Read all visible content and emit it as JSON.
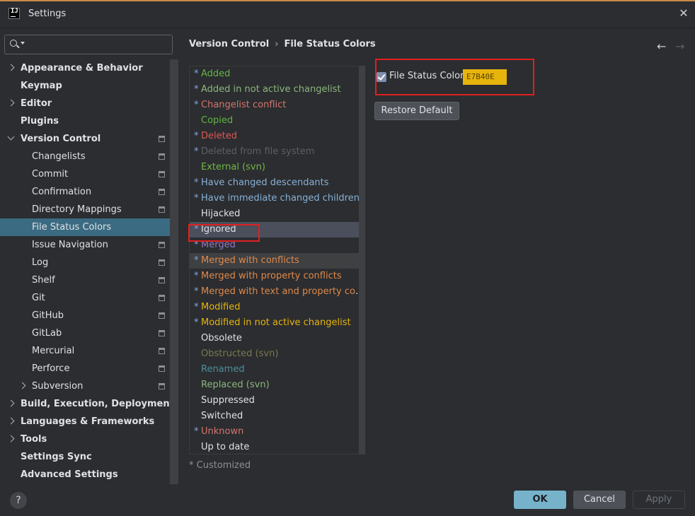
{
  "window": {
    "title": "Settings",
    "app_icon_text": "IJ"
  },
  "search": {
    "placeholder": ""
  },
  "sidebar": {
    "items": [
      {
        "label": "Appearance & Behavior",
        "level": 0,
        "bold": true,
        "chevron": "right",
        "proj": false
      },
      {
        "label": "Keymap",
        "level": 0,
        "bold": true,
        "chevron": "",
        "proj": false
      },
      {
        "label": "Editor",
        "level": 0,
        "bold": true,
        "chevron": "right",
        "proj": false
      },
      {
        "label": "Plugins",
        "level": 0,
        "bold": true,
        "chevron": "",
        "proj": false
      },
      {
        "label": "Version Control",
        "level": 0,
        "bold": true,
        "chevron": "down",
        "proj": true
      },
      {
        "label": "Changelists",
        "level": 1,
        "bold": false,
        "chevron": "",
        "proj": true
      },
      {
        "label": "Commit",
        "level": 1,
        "bold": false,
        "chevron": "",
        "proj": true
      },
      {
        "label": "Confirmation",
        "level": 1,
        "bold": false,
        "chevron": "",
        "proj": true
      },
      {
        "label": "Directory Mappings",
        "level": 1,
        "bold": false,
        "chevron": "",
        "proj": true
      },
      {
        "label": "File Status Colors",
        "level": 1,
        "bold": false,
        "chevron": "",
        "proj": false,
        "selected": true
      },
      {
        "label": "Issue Navigation",
        "level": 1,
        "bold": false,
        "chevron": "",
        "proj": true
      },
      {
        "label": "Log",
        "level": 1,
        "bold": false,
        "chevron": "",
        "proj": true
      },
      {
        "label": "Shelf",
        "level": 1,
        "bold": false,
        "chevron": "",
        "proj": true
      },
      {
        "label": "Git",
        "level": 1,
        "bold": false,
        "chevron": "",
        "proj": true
      },
      {
        "label": "GitHub",
        "level": 1,
        "bold": false,
        "chevron": "",
        "proj": true
      },
      {
        "label": "GitLab",
        "level": 1,
        "bold": false,
        "chevron": "",
        "proj": true
      },
      {
        "label": "Mercurial",
        "level": 1,
        "bold": false,
        "chevron": "",
        "proj": true
      },
      {
        "label": "Perforce",
        "level": 1,
        "bold": false,
        "chevron": "",
        "proj": true
      },
      {
        "label": "Subversion",
        "level": 1,
        "bold": false,
        "chevron": "right",
        "proj": true
      },
      {
        "label": "Build, Execution, Deployment",
        "level": 0,
        "bold": true,
        "chevron": "right",
        "proj": false
      },
      {
        "label": "Languages & Frameworks",
        "level": 0,
        "bold": true,
        "chevron": "right",
        "proj": false
      },
      {
        "label": "Tools",
        "level": 0,
        "bold": true,
        "chevron": "right",
        "proj": false
      },
      {
        "label": "Settings Sync",
        "level": 0,
        "bold": true,
        "chevron": "",
        "proj": false
      },
      {
        "label": "Advanced Settings",
        "level": 0,
        "bold": true,
        "chevron": "",
        "proj": false
      }
    ]
  },
  "breadcrumb": {
    "parent": "Version Control",
    "separator": "›",
    "current": "File Status Colors"
  },
  "nav": {
    "back": "←",
    "forward": "→"
  },
  "file_statuses": [
    {
      "label": "Added",
      "customized": true,
      "color": "#62b543"
    },
    {
      "label": "Added in not active changelist",
      "customized": true,
      "color": "#8db67c"
    },
    {
      "label": "Changelist conflict",
      "customized": true,
      "color": "#d5756c"
    },
    {
      "label": "Copied",
      "customized": false,
      "color": "#62b543"
    },
    {
      "label": "Deleted",
      "customized": true,
      "color": "#e05555"
    },
    {
      "label": "Deleted from file system",
      "customized": true,
      "color": "#5c5f64"
    },
    {
      "label": "External (svn)",
      "customized": false,
      "color": "#72b742"
    },
    {
      "label": "Have changed descendants",
      "customized": true,
      "color": "#88b0d6"
    },
    {
      "label": "Have immediate changed children",
      "customized": true,
      "color": "#88b0d6"
    },
    {
      "label": "Hijacked",
      "customized": false,
      "color": "#dfe1e5"
    },
    {
      "label": "Ignored",
      "customized": true,
      "color": "#dfe1e5",
      "selected": true
    },
    {
      "label": "Merged",
      "customized": true,
      "color": "#9876c5"
    },
    {
      "label": "Merged with conflicts",
      "customized": true,
      "color": "#e0884a",
      "hover": true
    },
    {
      "label": "Merged with property conflicts",
      "customized": true,
      "color": "#e0884a"
    },
    {
      "label": "Merged with text and property conflicts",
      "customized": true,
      "color": "#e0884a"
    },
    {
      "label": "Modified",
      "customized": true,
      "color": "#e7b40e"
    },
    {
      "label": "Modified in not active changelist",
      "customized": true,
      "color": "#e7b40e"
    },
    {
      "label": "Obsolete",
      "customized": false,
      "color": "#dfe1e5"
    },
    {
      "label": "Obstructed (svn)",
      "customized": false,
      "color": "#7a7a4c"
    },
    {
      "label": "Renamed",
      "customized": false,
      "color": "#4c8f9a"
    },
    {
      "label": "Replaced (svn)",
      "customized": false,
      "color": "#8db67c"
    },
    {
      "label": "Suppressed",
      "customized": false,
      "color": "#dfe1e5"
    },
    {
      "label": "Switched",
      "customized": false,
      "color": "#dfe1e5"
    },
    {
      "label": "Unknown",
      "customized": true,
      "color": "#d5756c"
    },
    {
      "label": "Up to date",
      "customized": false,
      "color": "#dfe1e5"
    }
  ],
  "customized_note": "* Customized",
  "file_status_color": {
    "label": "File Status Color:",
    "checked": true,
    "value": "E7B40E",
    "color": "#e7b40e"
  },
  "restore_default_label": "Restore Default",
  "buttons": {
    "help": "?",
    "ok": "OK",
    "cancel": "Cancel",
    "apply": "Apply"
  },
  "colors": {
    "accent": "#76b3cb",
    "selection": "#3b6b82",
    "annotation": "#e02020"
  }
}
